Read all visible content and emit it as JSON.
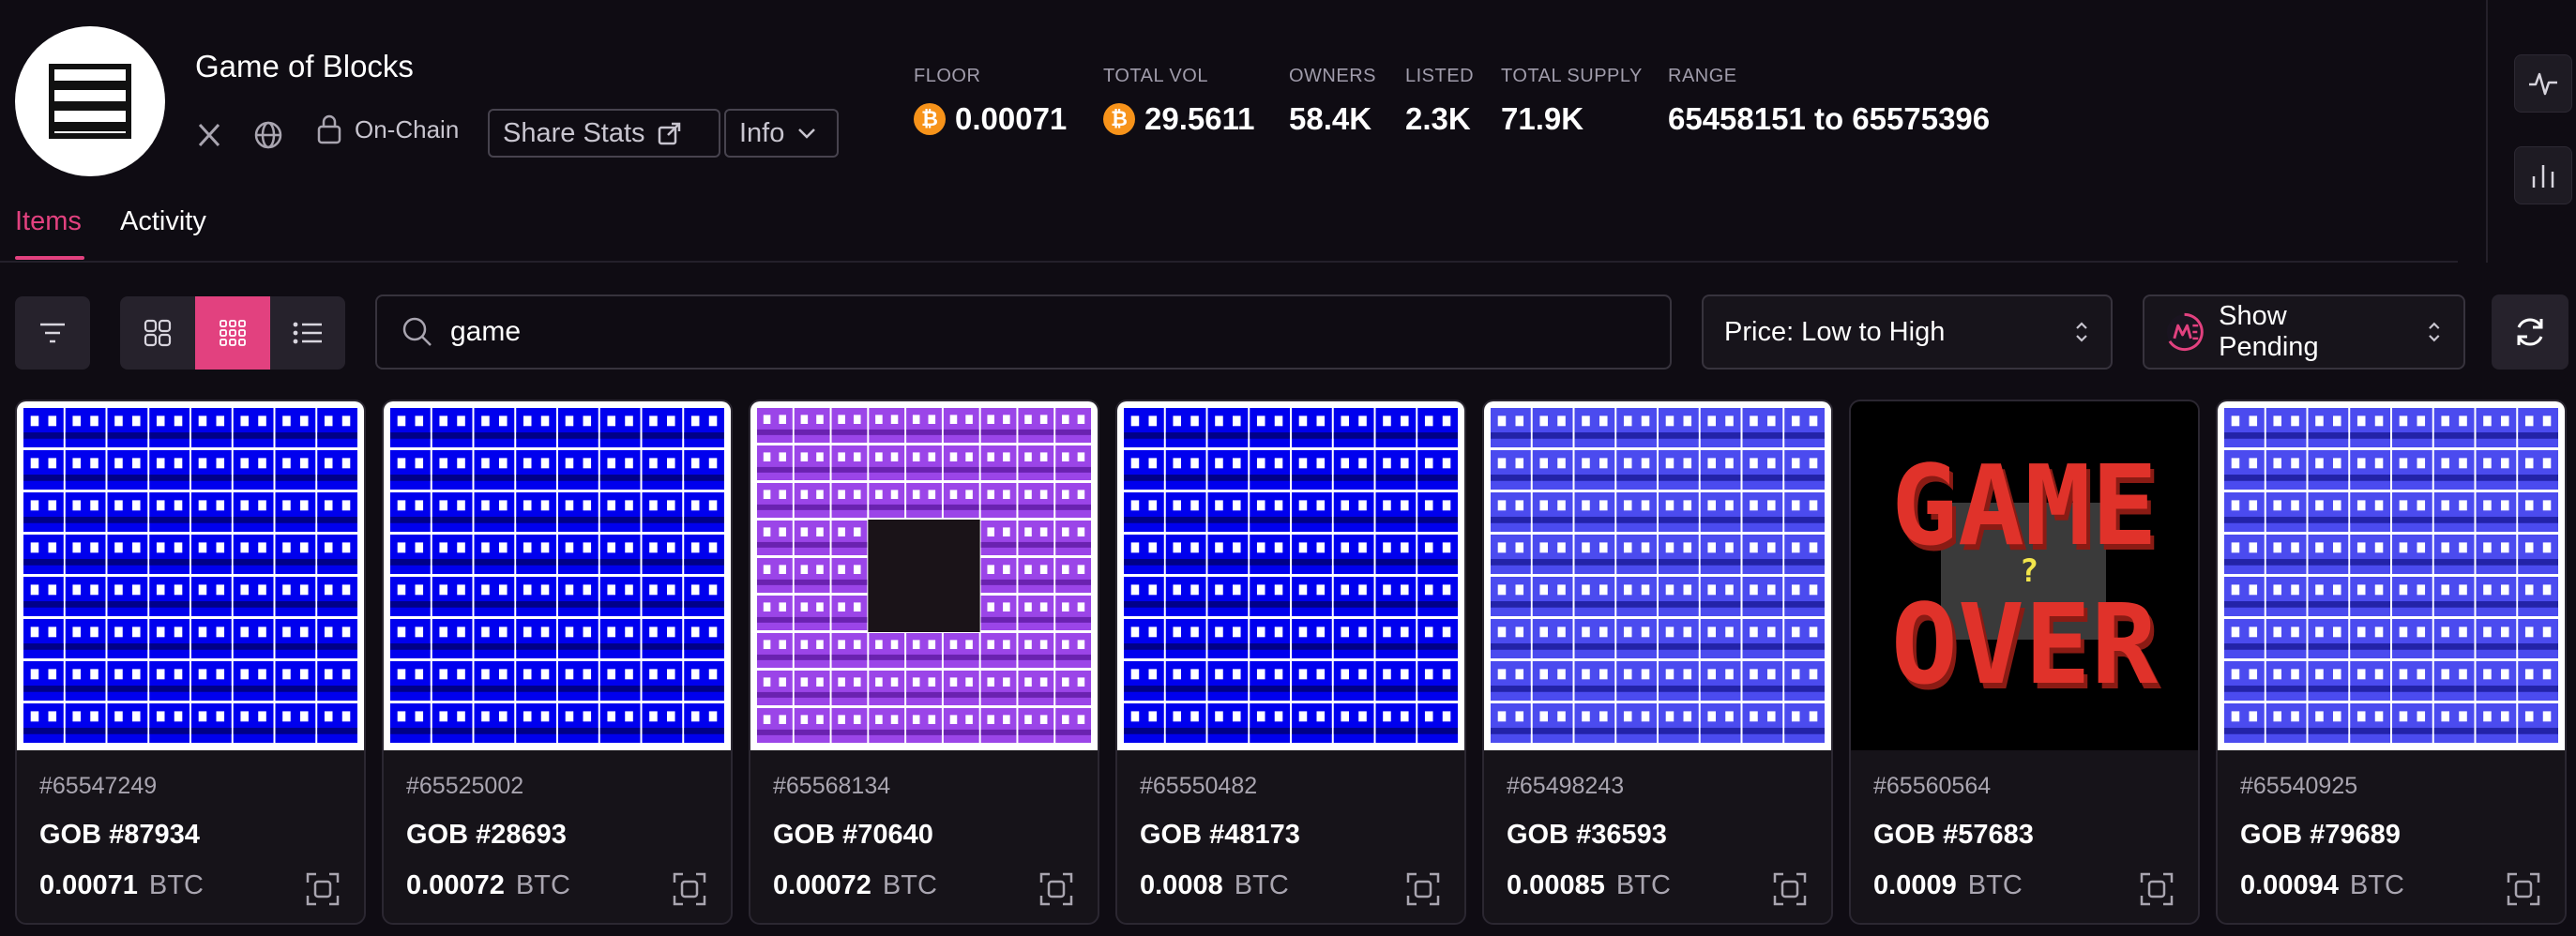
{
  "collection": {
    "name": "Game of Blocks",
    "onchain_label": "On-Chain",
    "share_label": "Share Stats",
    "info_label": "Info"
  },
  "stats": [
    {
      "label": "FLOOR",
      "value": "0.00071",
      "btc": true
    },
    {
      "label": "TOTAL VOL",
      "value": "29.5611",
      "btc": true
    },
    {
      "label": "OWNERS",
      "value": "58.4K",
      "btc": false
    },
    {
      "label": "LISTED",
      "value": "2.3K",
      "btc": false
    },
    {
      "label": "TOTAL SUPPLY",
      "value": "71.9K",
      "btc": false
    },
    {
      "label": "RANGE",
      "value": "65458151 to 65575396",
      "btc": false
    }
  ],
  "btc_symbol": "₿",
  "tabs": {
    "items": "Items",
    "activity": "Activity"
  },
  "search": {
    "value": "game"
  },
  "sort": {
    "selected": "Price: Low to High"
  },
  "pending": {
    "label": "Show Pending"
  },
  "colors": {
    "accent": "#e2417f",
    "btc": "#f7931a"
  },
  "cards": [
    {
      "inscription": "#65547249",
      "name": "GOB #87934",
      "price": "0.00071",
      "currency": "BTC",
      "art": "blue-grid"
    },
    {
      "inscription": "#65525002",
      "name": "GOB #28693",
      "price": "0.00072",
      "currency": "BTC",
      "art": "blue-grid"
    },
    {
      "inscription": "#65568134",
      "name": "GOB #70640",
      "price": "0.00072",
      "currency": "BTC",
      "art": "purple-grid-hole"
    },
    {
      "inscription": "#65550482",
      "name": "GOB #48173",
      "price": "0.0008",
      "currency": "BTC",
      "art": "blue-grid"
    },
    {
      "inscription": "#65498243",
      "name": "GOB #36593",
      "price": "0.00085",
      "currency": "BTC",
      "art": "periwinkle-grid"
    },
    {
      "inscription": "#65560564",
      "name": "GOB #57683",
      "price": "0.0009",
      "currency": "BTC",
      "art": "game-over"
    },
    {
      "inscription": "#65540925",
      "name": "GOB #79689",
      "price": "0.00094",
      "currency": "BTC",
      "art": "periwinkle-grid"
    }
  ]
}
